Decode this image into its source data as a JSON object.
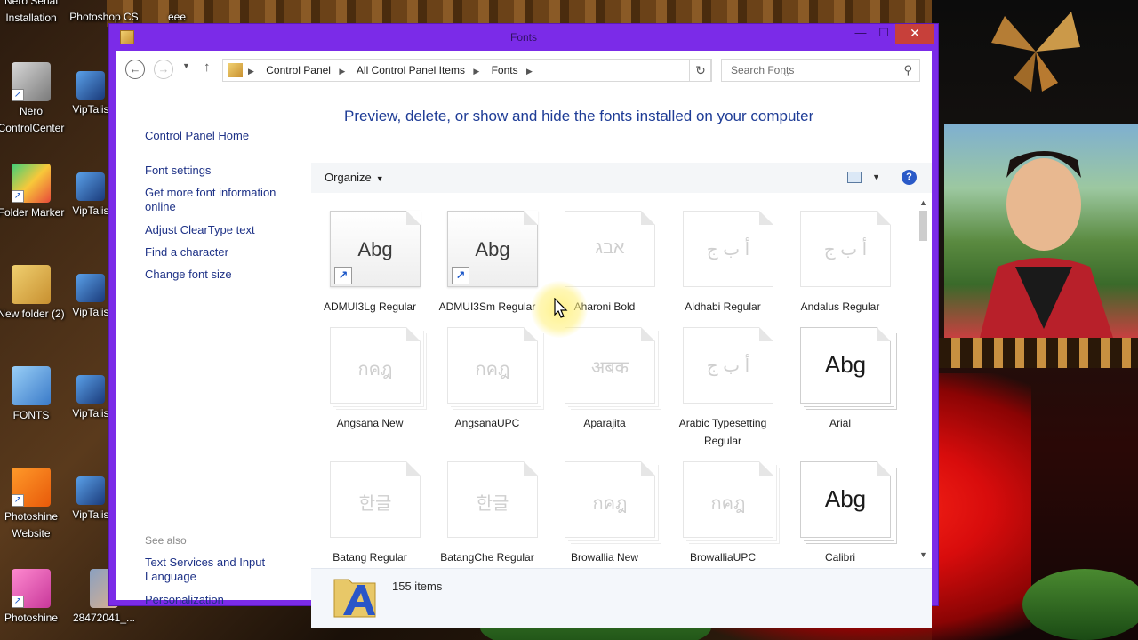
{
  "desktop": {
    "icons": [
      {
        "label": "Nero Serial Installation",
        "icon": "nero-icon"
      },
      {
        "label": "Photoshop CS",
        "icon": "photoshop-icon"
      },
      {
        "label": "eee",
        "icon": "file-icon"
      },
      {
        "label": "Nero ControlCenter",
        "icon": "nero-icon"
      },
      {
        "label": "VipTalis",
        "icon": "viptalis-icon"
      },
      {
        "label": "Folder Marker",
        "icon": "folder-marker-icon"
      },
      {
        "label": "VipTalis",
        "icon": "viptalis-icon"
      },
      {
        "label": "New folder (2)",
        "icon": "folder-icon"
      },
      {
        "label": "VipTalis",
        "icon": "viptalis-icon"
      },
      {
        "label": "FONTS",
        "icon": "folder-icon"
      },
      {
        "label": "VipTalis",
        "icon": "viptalis-icon"
      },
      {
        "label": "Photoshine Website",
        "icon": "uc-browser-icon"
      },
      {
        "label": "VipTalis",
        "icon": "viptalis-icon"
      },
      {
        "label": "Photoshine",
        "icon": "photoshine-icon"
      },
      {
        "label": "28472041_...",
        "icon": "image-icon"
      }
    ]
  },
  "window": {
    "title": "Fonts",
    "minimize": "—",
    "maximize": "☐",
    "close": "✕"
  },
  "nav": {
    "back": "←",
    "forward": "→",
    "history": "▼",
    "up": "↑",
    "breadcrumbs": [
      "Control Panel",
      "All Control Panel Items",
      "Fonts"
    ],
    "breadcrumb_sep": "▶",
    "dropdown": "⌵",
    "refresh": "↻",
    "search_placeholder": "Search Fonts",
    "search_icon": "⚲"
  },
  "left_pane": {
    "home": "Control Panel Home",
    "links": [
      "Font settings",
      "Get more font information online",
      "Adjust ClearType text",
      "Find a character",
      "Change font size"
    ],
    "see_also_label": "See also",
    "see_also": [
      "Text Services and Input Language",
      "Personalization"
    ]
  },
  "main": {
    "heading": "Preview, delete, or show and hide the fonts installed on your computer",
    "organize": "Organize",
    "organize_caret": "▼",
    "view_caret": "▼",
    "help": "?",
    "fonts": [
      {
        "name": "ADMUI3Lg Regular",
        "glyph": "Abg",
        "dim": false,
        "stack": false,
        "shortcut": true,
        "big": false
      },
      {
        "name": "ADMUI3Sm Regular",
        "glyph": "Abg",
        "dim": false,
        "stack": false,
        "shortcut": true,
        "big": false
      },
      {
        "name": "Aharoni Bold",
        "glyph": "אבג",
        "dim": true,
        "stack": false,
        "shortcut": false,
        "big": false
      },
      {
        "name": "Aldhabi Regular",
        "glyph": "أ ب ج",
        "dim": true,
        "stack": false,
        "shortcut": false,
        "big": false
      },
      {
        "name": "Andalus Regular",
        "glyph": "أ ب ج",
        "dim": true,
        "stack": false,
        "shortcut": false,
        "big": false
      },
      {
        "name": "Angsana New",
        "glyph": "กคฎ",
        "dim": true,
        "stack": true,
        "shortcut": false,
        "big": false
      },
      {
        "name": "AngsanaUPC",
        "glyph": "กคฎ",
        "dim": true,
        "stack": true,
        "shortcut": false,
        "big": false
      },
      {
        "name": "Aparajita",
        "glyph": "अबक",
        "dim": true,
        "stack": true,
        "shortcut": false,
        "big": false
      },
      {
        "name": "Arabic Typesetting Regular",
        "glyph": "أ ب ج",
        "dim": true,
        "stack": false,
        "shortcut": false,
        "big": false
      },
      {
        "name": "Arial",
        "glyph": "Abg",
        "dim": false,
        "stack": true,
        "shortcut": false,
        "big": true
      },
      {
        "name": "Batang Regular",
        "glyph": "한글",
        "dim": true,
        "stack": false,
        "shortcut": false,
        "big": false
      },
      {
        "name": "BatangChe Regular",
        "glyph": "한글",
        "dim": true,
        "stack": false,
        "shortcut": false,
        "big": false
      },
      {
        "name": "Browallia New",
        "glyph": "กคฎ",
        "dim": true,
        "stack": true,
        "shortcut": false,
        "big": false
      },
      {
        "name": "BrowalliaUPC",
        "glyph": "กคฎ",
        "dim": true,
        "stack": true,
        "shortcut": false,
        "big": false
      },
      {
        "name": "Calibri",
        "glyph": "Abg",
        "dim": false,
        "stack": true,
        "shortcut": false,
        "big": true
      }
    ],
    "scroll_up": "▲",
    "scroll_down": "▼"
  },
  "details": {
    "count": "155 items"
  },
  "colors": {
    "window_frame": "#7b2be8",
    "link": "#1e3287",
    "heading": "#1e3c96",
    "close_button": "#c7403a"
  }
}
